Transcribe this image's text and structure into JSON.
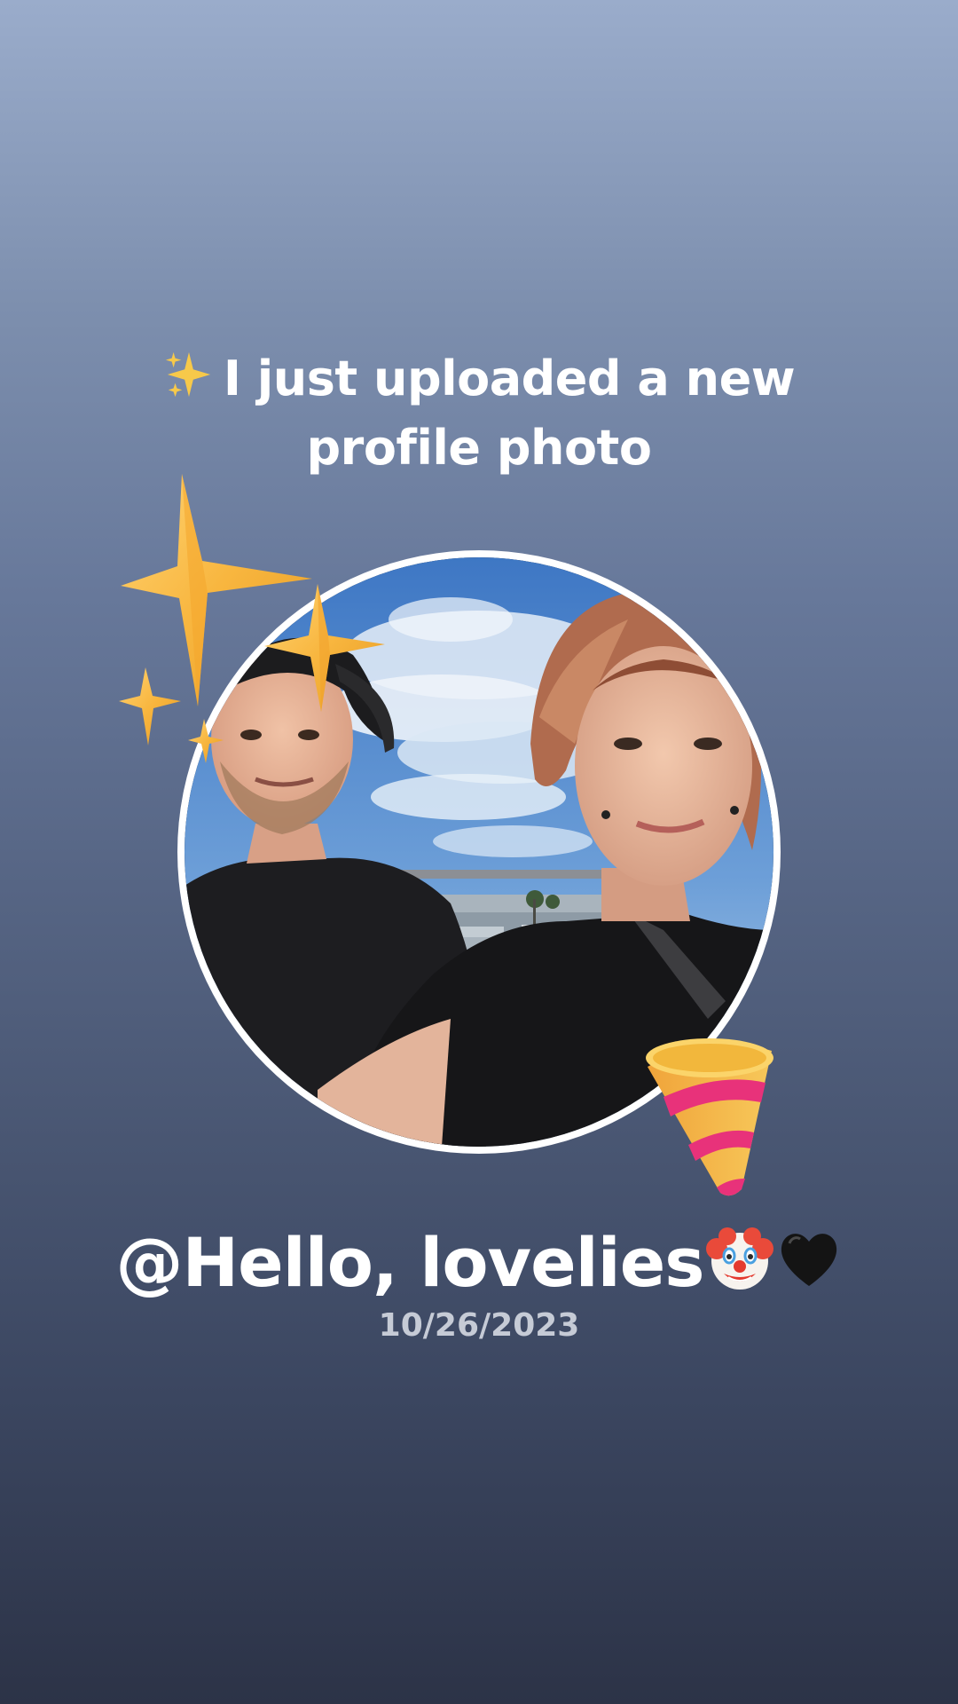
{
  "headline": {
    "icon": "sparkles-icon",
    "line1": "I just uploaded a new",
    "line2": "profile photo"
  },
  "profile_photo": {
    "alt": "profile photo"
  },
  "decorations": {
    "top_left": "sparkles-icon",
    "bottom_right": "party-popper-icon"
  },
  "user": {
    "name": "@Hello, lovelies",
    "emojis": [
      "clown-face-icon",
      "black-heart-icon"
    ]
  },
  "date": "10/26/2023",
  "colors": {
    "background_top": "#9aaccb",
    "background_bottom": "#2c3347",
    "text": "#ffffff",
    "date_text": "#c6cbd6",
    "sparkle": "#f5b43a",
    "popper_stripe": "#e8327a"
  }
}
